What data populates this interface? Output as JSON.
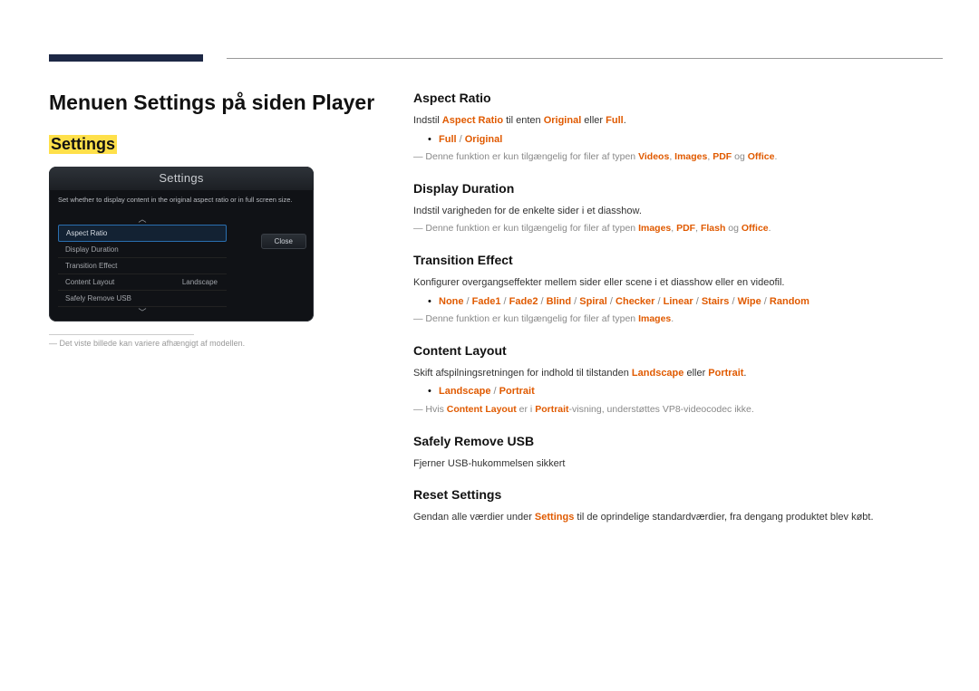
{
  "header": {},
  "left": {
    "title": "Menuen Settings på siden Player",
    "highlight": "Settings",
    "device": {
      "title": "Settings",
      "desc": "Set whether to display content in the original aspect ratio or in full screen size.",
      "items": [
        {
          "label": "Aspect Ratio",
          "value": ""
        },
        {
          "label": "Display Duration",
          "value": ""
        },
        {
          "label": "Transition Effect",
          "value": ""
        },
        {
          "label": "Content Layout",
          "value": "Landscape"
        },
        {
          "label": "Safely Remove USB",
          "value": ""
        }
      ],
      "close": "Close"
    },
    "footnote": "Det viste billede kan variere afhængigt af modellen."
  },
  "sections": {
    "aspect": {
      "title": "Aspect Ratio",
      "intro_pre": "Indstil ",
      "intro_mid": " til enten ",
      "intro_or": " eller ",
      "bold1": "Aspect Ratio",
      "bold2": "Original",
      "bold3": "Full",
      "period": ".",
      "bullet_a": "Full",
      "bullet_b": "Original",
      "note_pre": "Denne funktion er kun tilgængelig for filer af typen ",
      "types": [
        "Videos",
        "Images",
        "PDF",
        "Office"
      ],
      "sep": ", ",
      "og": " og "
    },
    "duration": {
      "title": "Display Duration",
      "intro": "Indstil varigheden for de enkelte sider i et diasshow.",
      "note_pre": "Denne funktion er kun tilgængelig for filer af typen ",
      "types": [
        "Images",
        "PDF",
        "Flash",
        "Office"
      ],
      "sep": ", ",
      "og": " og "
    },
    "transition": {
      "title": "Transition Effect",
      "intro": "Konfigurer overgangseffekter mellem sider eller scene i et diasshow eller en videofil.",
      "options": [
        "None",
        "Fade1",
        "Fade2",
        "Blind",
        "Spiral",
        "Checker",
        "Linear",
        "Stairs",
        "Wipe",
        "Random"
      ],
      "note_pre": "Denne funktion er kun tilgængelig for filer af typen ",
      "note_type": "Images"
    },
    "content": {
      "title": "Content Layout",
      "intro_pre": "Skift afspilningsretningen for indhold til tilstanden ",
      "bold1": "Landscape",
      "intro_or": " eller ",
      "bold2": "Portrait",
      "period": ".",
      "bullet_a": "Landscape",
      "bullet_b": "Portrait",
      "note_pre": "Hvis ",
      "note_b1": "Content Layout",
      "note_mid": " er i ",
      "note_b2": "Portrait",
      "note_suf": "-visning, understøttes VP8-videocodec ikke."
    },
    "usb": {
      "title": "Safely Remove USB",
      "intro": "Fjerner USB-hukommelsen sikkert"
    },
    "reset": {
      "title": "Reset Settings",
      "intro_pre": "Gendan alle værdier under ",
      "bold": "Settings",
      "intro_suf": " til de oprindelige standardværdier, fra dengang produktet blev købt."
    }
  }
}
